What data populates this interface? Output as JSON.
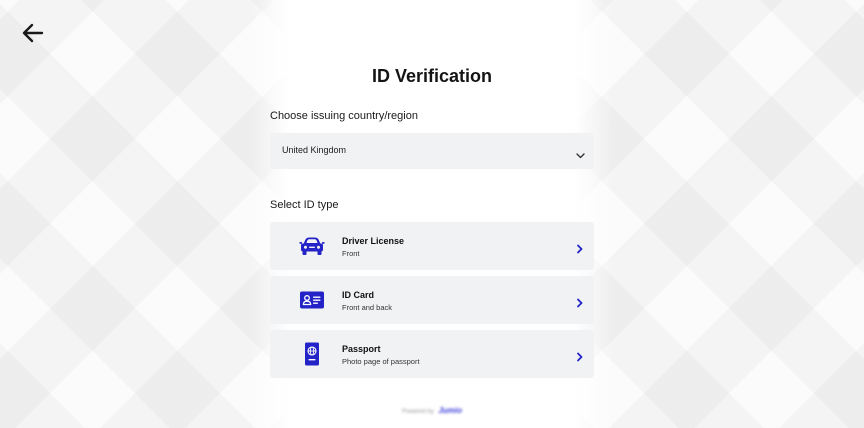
{
  "page": {
    "title": "ID Verification"
  },
  "country": {
    "label": "Choose issuing country/region",
    "selected": "United Kingdom"
  },
  "id_type": {
    "label": "Select ID type",
    "options": [
      {
        "title": "Driver License",
        "subtitle": "Front",
        "icon": "car-icon"
      },
      {
        "title": "ID Card",
        "subtitle": "Front and back",
        "icon": "id-card-icon"
      },
      {
        "title": "Passport",
        "subtitle": "Photo page of passport",
        "icon": "passport-icon"
      }
    ]
  },
  "footer": {
    "powered_by": "Powered by",
    "brand": "Jumio"
  },
  "colors": {
    "accent": "#2323c7",
    "card_background": "#f1f2f4",
    "text": "#111111"
  }
}
